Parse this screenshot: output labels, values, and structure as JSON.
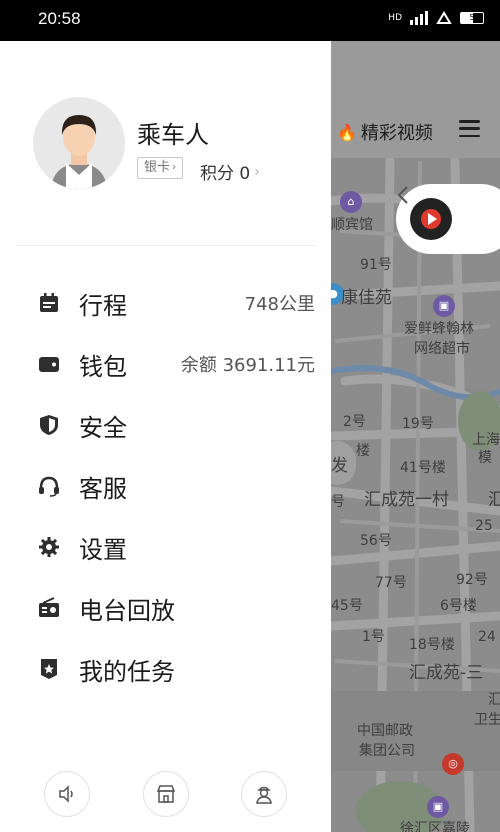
{
  "status_bar": {
    "time": "20:58",
    "network_label": "HD",
    "battery_level": "5"
  },
  "drawer": {
    "user": {
      "name": "乘车人",
      "card_label": "银卡",
      "points_label": "积分 0"
    },
    "menu": [
      {
        "label": "行程",
        "value": "748公里",
        "icon": "calendar-icon"
      },
      {
        "label": "钱包",
        "value": "余额 3691.11元",
        "icon": "wallet-icon"
      },
      {
        "label": "安全",
        "value": "",
        "icon": "shield-icon"
      },
      {
        "label": "客服",
        "value": "",
        "icon": "headset-icon"
      },
      {
        "label": "设置",
        "value": "",
        "icon": "gear-icon"
      },
      {
        "label": "电台回放",
        "value": "",
        "icon": "radio-icon"
      },
      {
        "label": "我的任务",
        "value": "",
        "icon": "task-badge-icon"
      }
    ],
    "bottom_icons": [
      "speaker-icon",
      "store-icon",
      "driver-icon"
    ]
  },
  "map": {
    "top_tab": "精彩视频",
    "labels": {
      "hotel": "顺宾馆",
      "no91": "91号",
      "kangjia": "康佳苑",
      "shop1": "爱鲜蜂翰林",
      "shop2": "网络超市",
      "no2": "2号",
      "no19": "19号",
      "lou": "楼",
      "no41": "41号楼",
      "shanghai": "上海",
      "mo": "模",
      "fa": "发",
      "huicheng1": "汇成苑一村",
      "hui": "汇",
      "no5": "号",
      "no25": "25",
      "no56": "56号",
      "no77": "77号",
      "no92": "92号",
      "no45": "45号",
      "no6": "6号楼",
      "no1": "1号",
      "no18": "18号楼",
      "no24": "24",
      "huicheng3": "汇成苑-三",
      "hui2": "汇",
      "wei": "卫生",
      "post1": "中国邮政",
      "post2": "集团公司",
      "xuhui": "徐汇区嘉陵"
    }
  },
  "colors": {
    "accent_red": "#e03a2f",
    "map_gray": "#8d8d8d",
    "icon_dark": "#2e2e2e"
  }
}
